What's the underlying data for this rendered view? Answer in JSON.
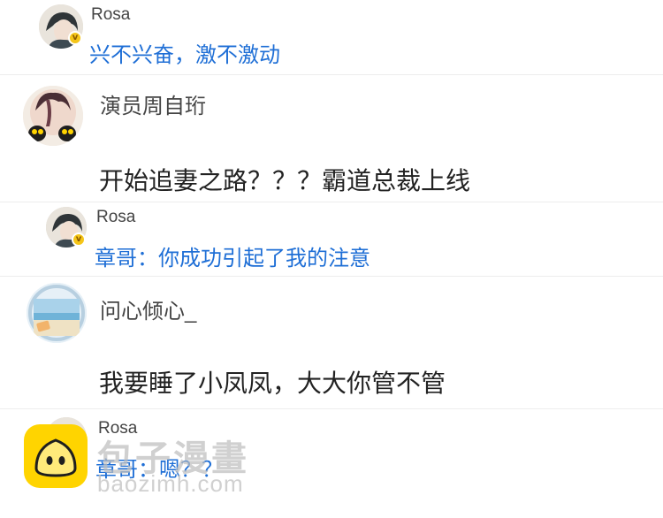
{
  "messages": [
    {
      "user": "Rosa",
      "badge": "v",
      "text": "兴不兴奋，激不激动"
    },
    {
      "user": "演员周自珩",
      "text": "开始追妻之路？？？霸道总裁上线"
    },
    {
      "user": "Rosa",
      "badge": "v",
      "text": "章哥：你成功引起了我的注意"
    },
    {
      "user": "问心倾心_",
      "text": "我要睡了小凤凤，大大你管不管"
    },
    {
      "user": "Rosa",
      "text": "章哥：嗯？？"
    }
  ],
  "watermark": {
    "name": "包子漫畫",
    "url": "baozimh.com"
  },
  "colors": {
    "reply_text": "#1f6fd6",
    "body_text": "#222222",
    "badge": "#f5c518",
    "logo": "#ffd400"
  }
}
